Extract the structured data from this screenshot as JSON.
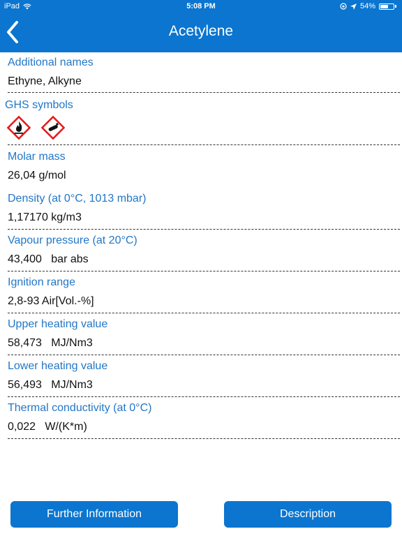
{
  "status_bar": {
    "device": "iPad",
    "time": "5:08 PM",
    "battery": "54%"
  },
  "nav": {
    "title": "Acetylene"
  },
  "properties": [
    {
      "label": "Additional names",
      "value": "Ethyne, Alkyne"
    },
    {
      "label": "Molar mass",
      "value": "26,04 g/mol"
    },
    {
      "label": "Density (at 0°C, 1013 mbar)",
      "value": "1,17170 kg/m3"
    },
    {
      "label": "Vapour pressure (at 20°C)",
      "value": "43,400   bar abs"
    },
    {
      "label": "Ignition range",
      "value": "2,8-93 Air[Vol.-%]"
    },
    {
      "label": "Upper heating value",
      "value": "58,473   MJ/Nm3"
    },
    {
      "label": "Lower heating value",
      "value": "56,493   MJ/Nm3"
    },
    {
      "label": "Thermal conductivity (at 0°C)",
      "value": "0,022   W/(K*m)"
    }
  ],
  "ghs": {
    "label": "GHS symbols",
    "symbols": [
      "flame-icon",
      "gas-cylinder-icon"
    ]
  },
  "buttons": {
    "further_information": "Further Information",
    "description": "Description"
  },
  "colors": {
    "accent": "#0b75cf",
    "label": "#2277c6",
    "ghs_border": "#e31b1b"
  }
}
